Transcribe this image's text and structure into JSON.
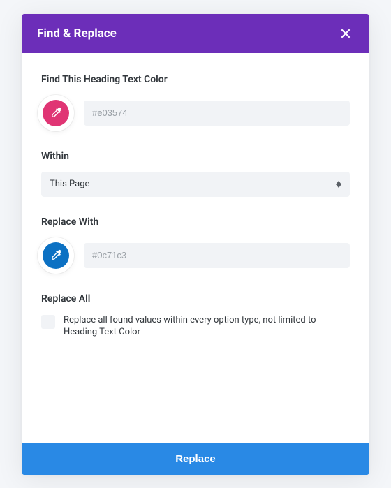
{
  "header": {
    "title": "Find & Replace"
  },
  "find": {
    "label": "Find This Heading Text Color",
    "color_hex": "#e03574",
    "input_value": "#e03574"
  },
  "within": {
    "label": "Within",
    "selected": "This Page"
  },
  "replace": {
    "label": "Replace With",
    "color_hex": "#0c71c3",
    "input_value": "#0c71c3"
  },
  "replace_all": {
    "label": "Replace All",
    "description": "Replace all found values within every option type, not limited to Heading Text Color"
  },
  "footer": {
    "button_label": "Replace"
  }
}
